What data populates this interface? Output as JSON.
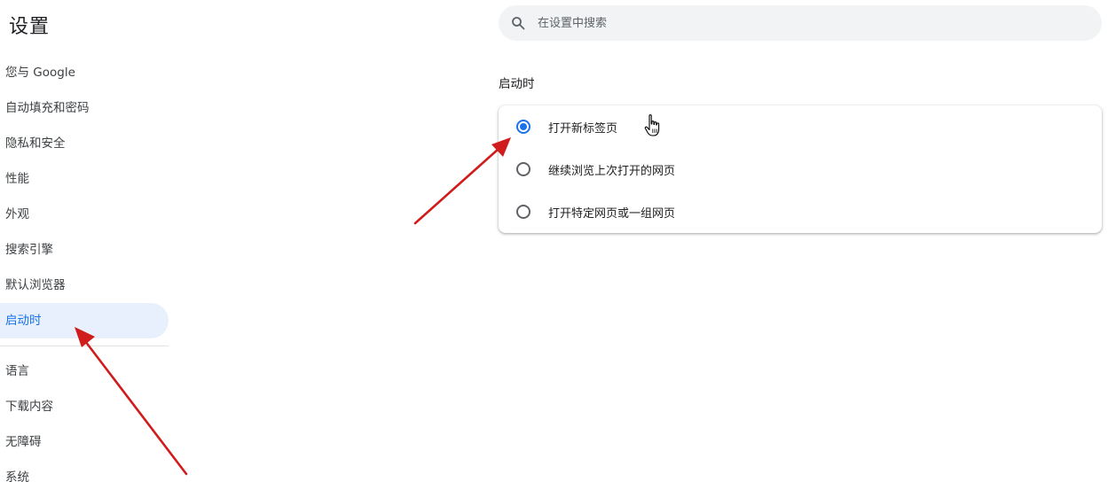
{
  "app": {
    "title": "设置"
  },
  "sidebar": {
    "items": [
      {
        "label": "您与 Google",
        "active": false
      },
      {
        "label": "自动填充和密码",
        "active": false
      },
      {
        "label": "隐私和安全",
        "active": false
      },
      {
        "label": "性能",
        "active": false
      },
      {
        "label": "外观",
        "active": false
      },
      {
        "label": "搜索引擎",
        "active": false
      },
      {
        "label": "默认浏览器",
        "active": false
      },
      {
        "label": "启动时",
        "active": true
      }
    ],
    "items_advanced": [
      {
        "label": "语言"
      },
      {
        "label": "下载内容"
      },
      {
        "label": "无障碍"
      },
      {
        "label": "系统"
      }
    ]
  },
  "search": {
    "placeholder": "在设置中搜索",
    "value": ""
  },
  "startup": {
    "section_title": "启动时",
    "options": [
      {
        "label": "打开新标签页",
        "checked": true
      },
      {
        "label": "继续浏览上次打开的网页",
        "checked": false
      },
      {
        "label": "打开特定网页或一组网页",
        "checked": false
      }
    ]
  },
  "colors": {
    "accent": "#1a73e8",
    "active_bg": "#e8f0fe",
    "annotation_arrow": "#d01c1c"
  }
}
